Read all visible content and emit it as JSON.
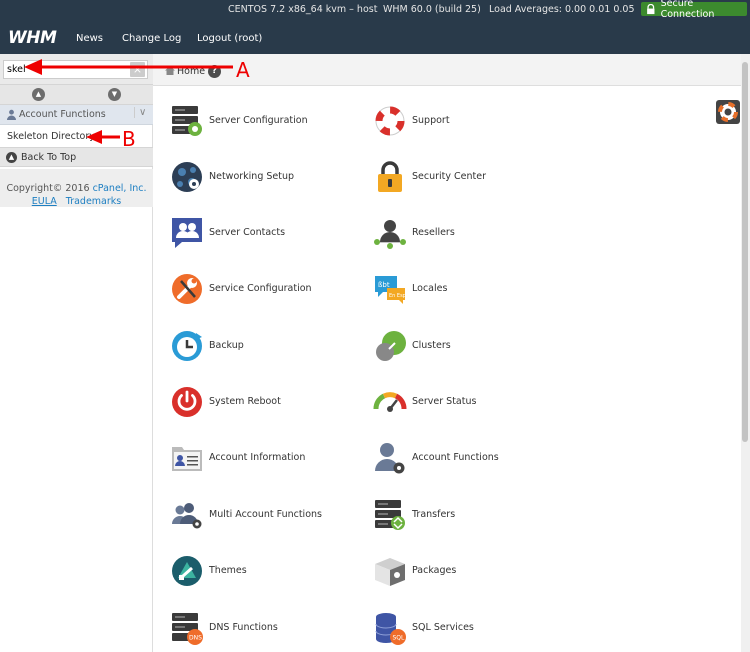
{
  "topbar": {
    "os": "CENTOS 7.2 x86_64 kvm – host",
    "version": "WHM 60.0 (build 25)",
    "load": "Load Averages: 0.00 0.01 0.05",
    "secure": "Secure Connection",
    "logo": "WHM",
    "nav": [
      "News",
      "Change Log",
      "Logout (root)"
    ]
  },
  "sidebar": {
    "search_value": "skel",
    "clear": "×",
    "category": "Account Functions",
    "result": "Skeleton Directory",
    "back_to_top": "Back To Top",
    "copyright_prefix": "Copyright© 2016 ",
    "copyright_company": "cPanel, Inc.",
    "eula": "EULA",
    "trademarks": "Trademarks"
  },
  "breadcrumb": {
    "home": "Home",
    "help": "?"
  },
  "annotations": {
    "a": "A",
    "b": "B"
  },
  "items": [
    {
      "label": "Server Configuration",
      "icon": "server-config-icon"
    },
    {
      "label": "Support",
      "icon": "lifebuoy-icon"
    },
    {
      "label": "Networking Setup",
      "icon": "networking-icon"
    },
    {
      "label": "Security Center",
      "icon": "lock-icon"
    },
    {
      "label": "Server Contacts",
      "icon": "contacts-icon"
    },
    {
      "label": "Resellers",
      "icon": "resellers-icon"
    },
    {
      "label": "Service Configuration",
      "icon": "wrench-icon"
    },
    {
      "label": "Locales",
      "icon": "locales-icon"
    },
    {
      "label": "Backup",
      "icon": "backup-icon"
    },
    {
      "label": "Clusters",
      "icon": "clusters-icon"
    },
    {
      "label": "System Reboot",
      "icon": "power-icon"
    },
    {
      "label": "Server Status",
      "icon": "gauge-icon"
    },
    {
      "label": "Account Information",
      "icon": "account-info-icon"
    },
    {
      "label": "Account Functions",
      "icon": "account-functions-icon"
    },
    {
      "label": "Multi Account Functions",
      "icon": "multi-account-icon"
    },
    {
      "label": "Transfers",
      "icon": "transfers-icon"
    },
    {
      "label": "Themes",
      "icon": "themes-icon"
    },
    {
      "label": "Packages",
      "icon": "packages-icon"
    },
    {
      "label": "DNS Functions",
      "icon": "dns-icon"
    },
    {
      "label": "SQL Services",
      "icon": "sql-icon"
    }
  ],
  "colors": {
    "topbar": "#293a4a",
    "secure": "#3c8a2e",
    "link": "#1e7fc2",
    "annotation": "#e00000"
  }
}
